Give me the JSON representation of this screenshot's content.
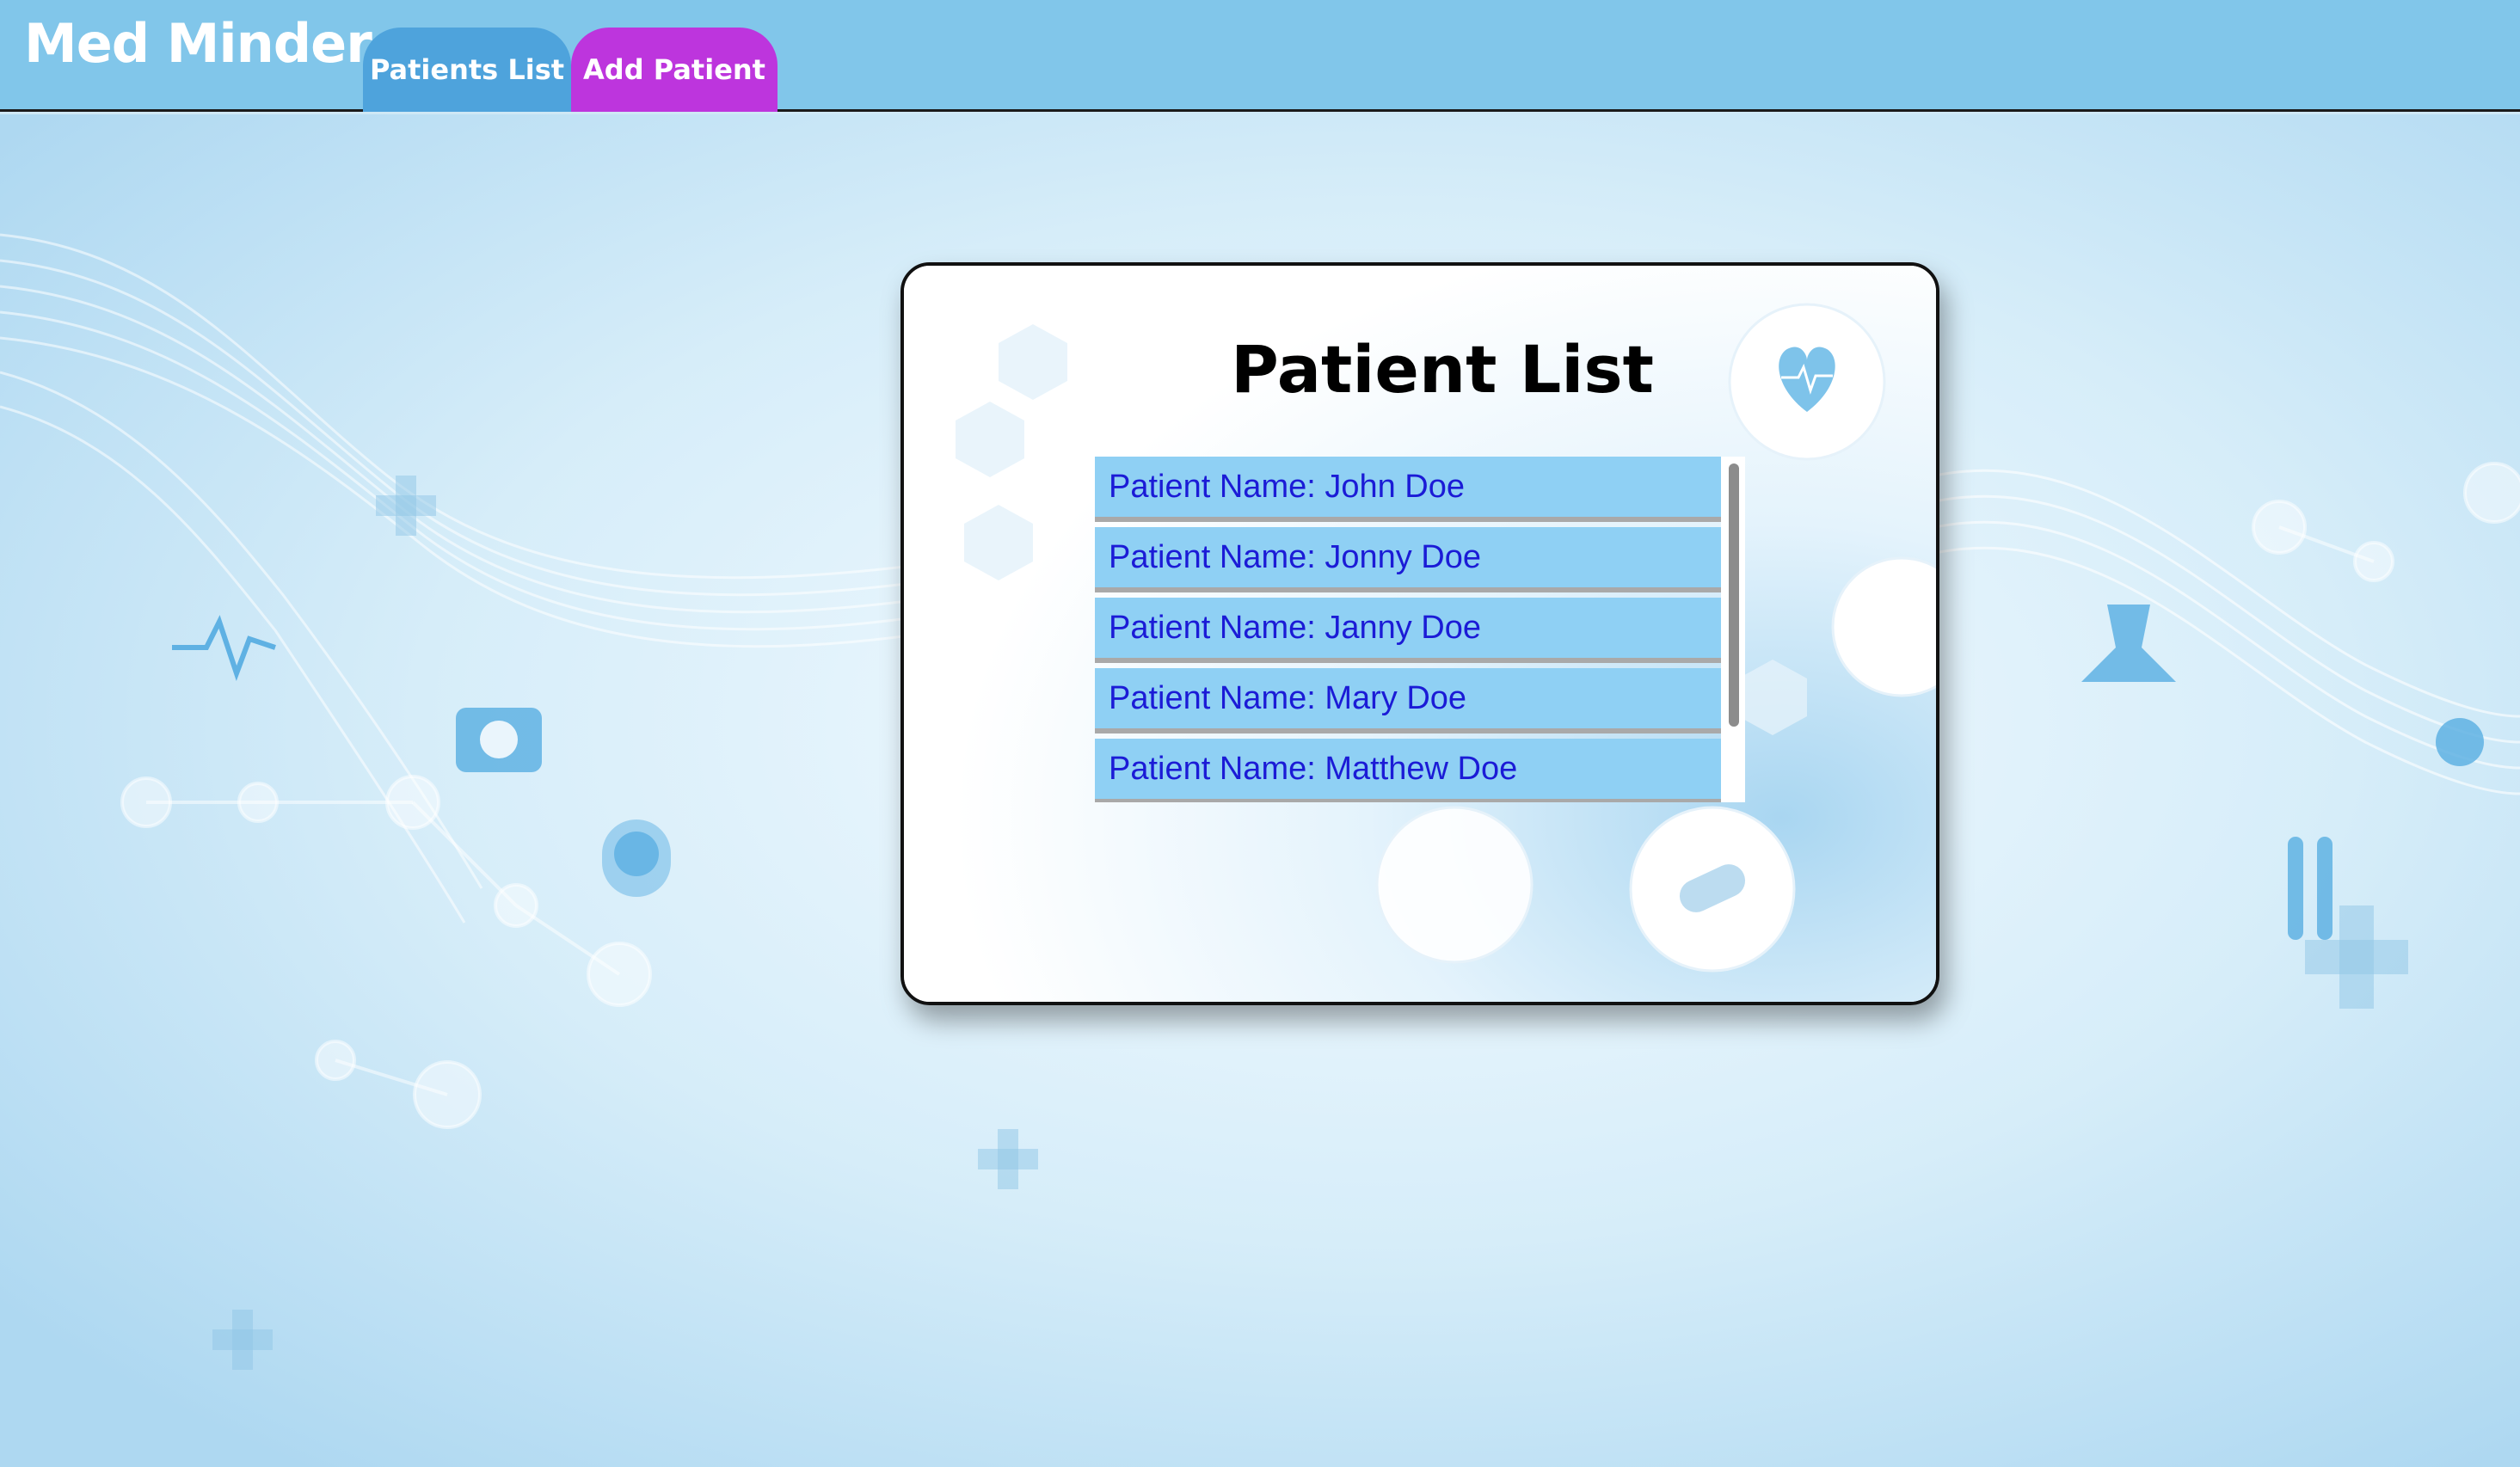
{
  "header": {
    "brand": "Med Minder",
    "tabs": [
      {
        "label": "Patients List",
        "color": "#4ea3dc"
      },
      {
        "label": "Add Patient",
        "color": "#bd35dd"
      }
    ]
  },
  "card": {
    "title": "Patient List",
    "patients": [
      {
        "label": "Patient Name: John Doe"
      },
      {
        "label": "Patient Name: Jonny Doe"
      },
      {
        "label": "Patient Name: Janny Doe"
      },
      {
        "label": "Patient Name: Mary Doe"
      },
      {
        "label": "Patient Name: Matthew Doe"
      }
    ]
  },
  "colors": {
    "header_bg": "#81c6ea",
    "row_bg": "#8fd0f4",
    "row_text": "#1b1bd6"
  }
}
